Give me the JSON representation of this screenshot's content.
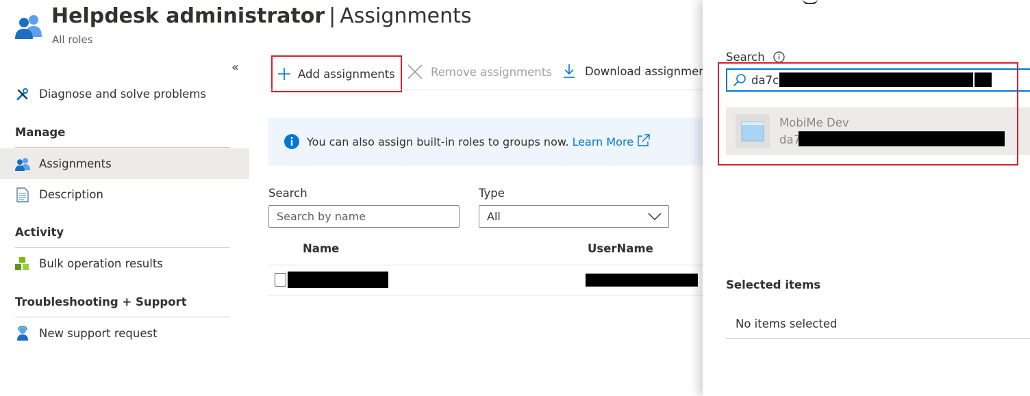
{
  "header": {
    "title_bold": "Helpdesk administrator",
    "title_separator": "|",
    "title_rest": "Assignments",
    "subtitle": "All roles"
  },
  "sidebar": {
    "collapse_glyph": "«",
    "items": [
      {
        "label": "Diagnose and solve problems",
        "icon": "wrench-icon"
      },
      {
        "section": "Manage"
      },
      {
        "label": "Assignments",
        "icon": "users-icon",
        "selected": true
      },
      {
        "label": "Description",
        "icon": "document-icon"
      },
      {
        "section": "Activity"
      },
      {
        "label": "Bulk operation results",
        "icon": "cubes-icon"
      },
      {
        "section": "Troubleshooting + Support"
      },
      {
        "label": "New support request",
        "icon": "support-person-icon"
      }
    ]
  },
  "toolbar": {
    "add_label": "Add assignments",
    "remove_label": "Remove assignments",
    "download_label": "Download assignmen"
  },
  "info_bar": {
    "text": "You can also assign built-in roles to groups now.",
    "link": "Learn More"
  },
  "filters": {
    "search_label": "Search",
    "search_placeholder": "Search by name",
    "type_label": "Type",
    "type_value": "All"
  },
  "table": {
    "columns": [
      "Name",
      "UserName"
    ]
  },
  "panel": {
    "search_label": "Search",
    "search_value": "da7cb",
    "result": {
      "name": "MobiMe Dev",
      "sub": "da7"
    },
    "selected_heading": "Selected items",
    "no_items": "No items selected"
  },
  "colors": {
    "accent": "#0078d4",
    "highlight_border": "#d9202a",
    "selected_bg": "#edebe9",
    "info_bg": "#eef5fd"
  }
}
